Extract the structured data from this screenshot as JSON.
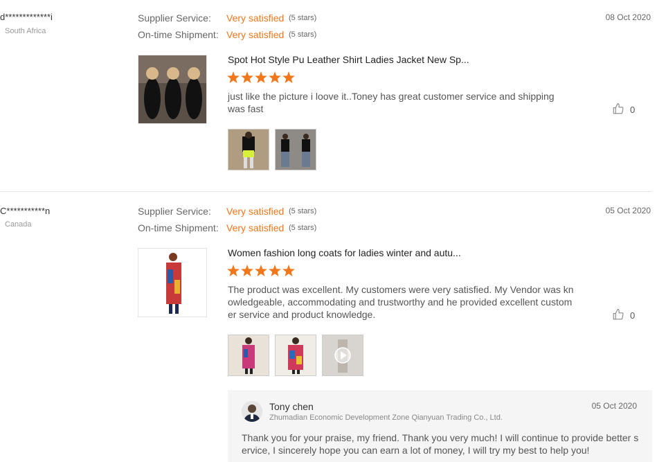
{
  "reviews": [
    {
      "user": "d*************i",
      "country": "South Africa",
      "supplier_label": "Supplier Service:",
      "supplier_value": "Very satisfied",
      "supplier_stars": "(5 stars)",
      "shipment_label": "On-time Shipment:",
      "shipment_value": "Very satisfied",
      "shipment_stars": "(5 stars)",
      "date": "08 Oct 2020",
      "product_title": "Spot Hot Style Pu Leather Shirt Ladies Jacket New Sp...",
      "rating": 5,
      "comment": "just like the picture i loove it..Toney has great customer service and shipping was fast",
      "helpful_count": "0",
      "photos": 2
    },
    {
      "user": "C***********n",
      "country": "Canada",
      "supplier_label": "Supplier Service:",
      "supplier_value": "Very satisfied",
      "supplier_stars": "(5 stars)",
      "shipment_label": "On-time Shipment:",
      "shipment_value": "Very satisfied",
      "shipment_stars": "(5 stars)",
      "date": "05 Oct 2020",
      "product_title": "Women fashion long coats for ladies winter and autu...",
      "rating": 5,
      "comment": "The product was excellent. My customers were very satisfied. My Vendor was knowledgeable, accommodating and trustworthy and he provided excellent customer service and product knowledge.",
      "helpful_count": "0",
      "photos": 3,
      "reply": {
        "name": "Tony chen",
        "company": "Zhumadian Economic Development Zone Qianyuan Trading Co., Ltd.",
        "date": "05 Oct 2020",
        "text": "Thank you for your praise, my friend. Thank you very much! I will continue to provide better service, I sincerely hope you can earn a lot of money, I will try my best to help you!"
      }
    }
  ],
  "colors": {
    "accent": "#f2761a",
    "star": "#f2761a",
    "reply_bg": "#f5f5f5"
  },
  "icons": {
    "helpful": "thumbs-up-icon",
    "star": "star-icon",
    "play": "play-icon"
  }
}
